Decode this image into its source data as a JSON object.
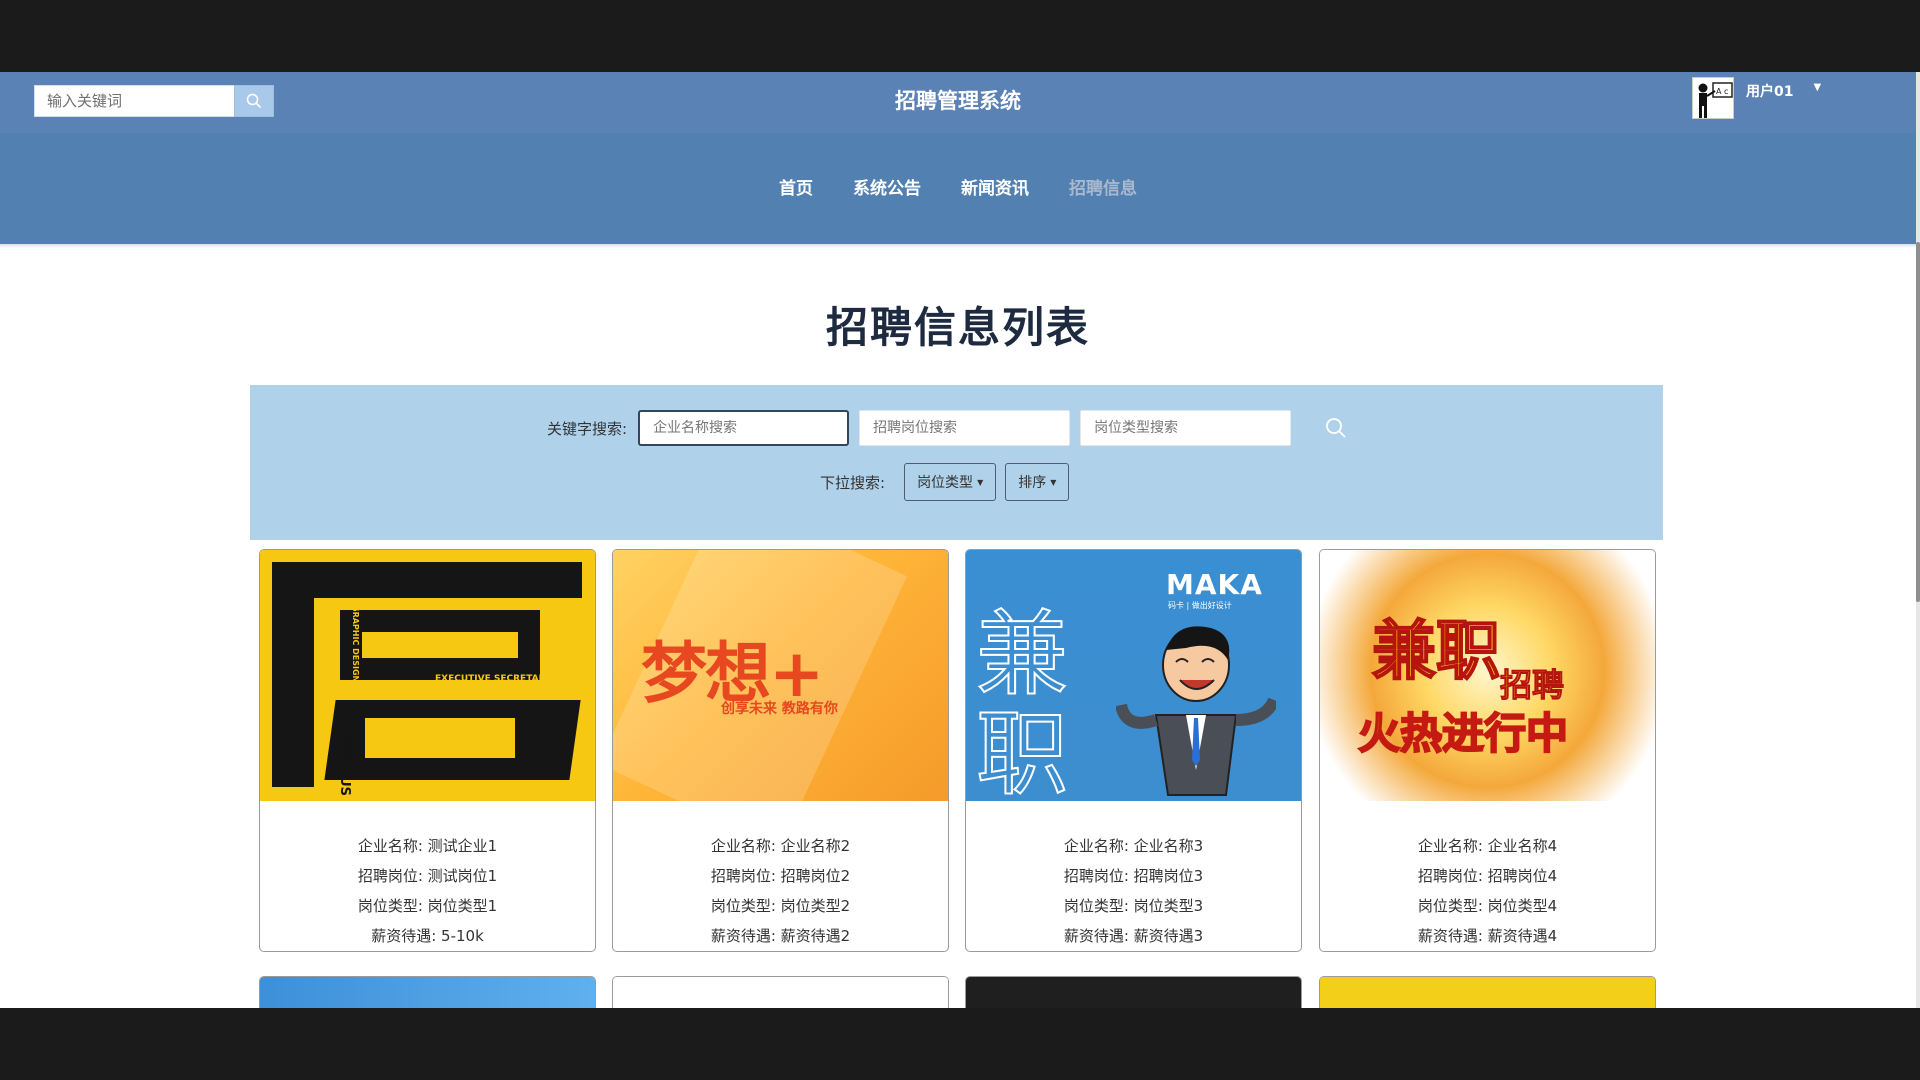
{
  "header": {
    "search_placeholder": "输入关键词",
    "site_title": "招聘管理系统",
    "user_name": "用户01"
  },
  "nav": {
    "items": [
      {
        "label": "首页",
        "active": false
      },
      {
        "label": "系统公告",
        "active": false
      },
      {
        "label": "新闻资讯",
        "active": false
      },
      {
        "label": "招聘信息",
        "active": true
      }
    ]
  },
  "main": {
    "title": "招聘信息列表",
    "search": {
      "keyword_label": "关键字搜索:",
      "company_placeholder": "企业名称搜索",
      "position_placeholder": "招聘岗位搜索",
      "type_placeholder": "岗位类型搜索",
      "dropdown_label": "下拉搜索:",
      "type_dropdown": "岗位类型",
      "sort_dropdown": "排序"
    },
    "cards": [
      {
        "image_text": [
          "聘",
          "JOIN US",
          "EXECUTIVE SECRETARY",
          "GRAPHIC DESIGNER"
        ],
        "company": "企业名称: 测试企业1",
        "position": "招聘岗位: 测试岗位1",
        "type": "岗位类型: 岗位类型1",
        "salary": "薪资待遇: 5-10k"
      },
      {
        "image_text": [
          "梦想+",
          "创享未来 教路有你"
        ],
        "company": "企业名称: 企业名称2",
        "position": "招聘岗位: 招聘岗位2",
        "type": "岗位类型: 岗位类型2",
        "salary": "薪资待遇: 薪资待遇2"
      },
      {
        "image_text": [
          "兼",
          "职",
          "MAKA",
          "码卡 | 做出好设计"
        ],
        "company": "企业名称: 企业名称3",
        "position": "招聘岗位: 招聘岗位3",
        "type": "岗位类型: 岗位类型3",
        "salary": "薪资待遇: 薪资待遇3"
      },
      {
        "image_text": [
          "兼职",
          "招聘",
          "火热进行中"
        ],
        "company": "企业名称: 企业名称4",
        "position": "招聘岗位: 招聘岗位4",
        "type": "岗位类型: 岗位类型4",
        "salary": "薪资待遇: 薪资待遇4"
      }
    ]
  },
  "colors": {
    "header_bg": "#5b82b4",
    "nav_bg": "#5180b1",
    "panel_bg": "#b0d1ea",
    "title": "#1d2a3f"
  }
}
